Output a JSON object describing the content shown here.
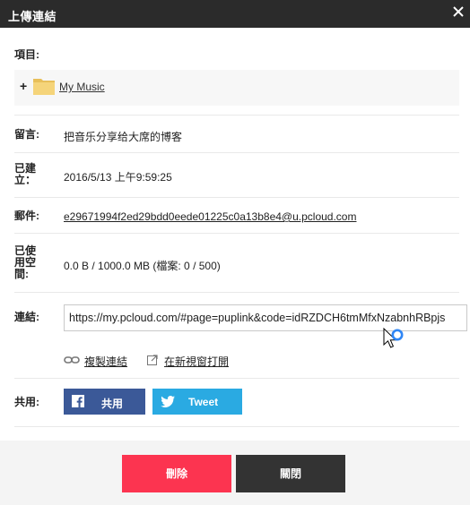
{
  "dialog": {
    "title": "上傳連結"
  },
  "fields": {
    "item_label": "項目:",
    "item_name": "My Music",
    "item_expand": "+",
    "comment_label": "留言:",
    "comment_value": "把音乐分享给大席的博客",
    "created_label_1": "已建",
    "created_label_2": "立：",
    "created_value": "2016/5/13 上午9:59:25",
    "email_label": "郵件:",
    "email_value": "e29671994f2ed29bdd0eede01225c0a13b8e4@u.pcloud.com",
    "space_label_1": "已使",
    "space_label_2": "用空",
    "space_label_3": "間:",
    "space_value": "0.0 B / 1000.0 MB (檔案: 0 / 500)",
    "link_label": "連結:",
    "link_value": "https://my.pcloud.com/#page=puplink&code=idRZDCH6tmMfxNzabnhRBpjs",
    "copy_link": "複製連結",
    "open_new_window": "在新視窗打開",
    "share_label": "共用:"
  },
  "share": {
    "facebook_label": "共用",
    "twitter_label": "Tweet"
  },
  "footer": {
    "delete_label": "刪除",
    "close_label": "關閉"
  },
  "colors": {
    "titlebar": "#2b2b2b",
    "facebook": "#3b5998",
    "twitter": "#2aaae2",
    "delete": "#fc3450",
    "close": "#333333",
    "folder": "#f5d47a"
  },
  "icons": [
    "close-icon",
    "folder-icon",
    "link-icon",
    "external-link-icon",
    "facebook-icon",
    "twitter-icon",
    "mouse-cursor-icon"
  ]
}
